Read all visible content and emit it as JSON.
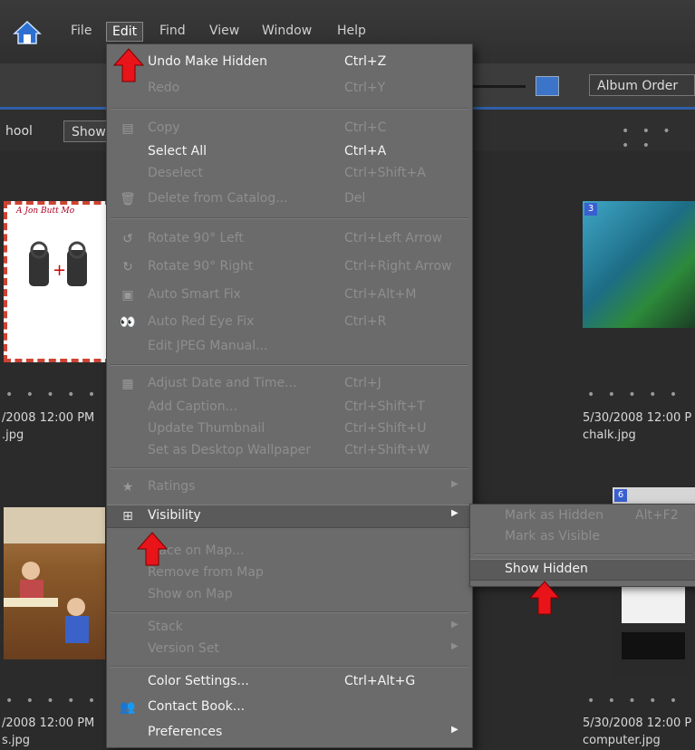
{
  "menubar": {
    "items": [
      {
        "label": "File"
      },
      {
        "label": "Edit"
      },
      {
        "label": "Find"
      },
      {
        "label": "View"
      },
      {
        "label": "Window"
      },
      {
        "label": "Help"
      }
    ]
  },
  "toolbar": {
    "album_order": "Album Order"
  },
  "subheader": {
    "breadcrumb_text": "hool",
    "show_button": "Show"
  },
  "thumbnails": [
    {
      "date": "/2008 12:00 PM",
      "filename": ".jpg"
    },
    {
      "date": "5/30/2008 12:00 P",
      "filename": "chalk.jpg",
      "badge": "3"
    },
    {
      "date": "/2008 12:00 PM",
      "filename": "s.jpg"
    },
    {
      "date": "5/30/2008 12:00 P",
      "filename": "computer.jpg",
      "badge": "6"
    }
  ],
  "thumbnail_stars": "• • • • •",
  "card_title": "A Jon Butt Mo",
  "edit_menu": {
    "items": [
      {
        "label": "Undo Make Hidden",
        "shortcut": "Ctrl+Z"
      },
      {
        "label": "Redo",
        "shortcut": "Ctrl+Y"
      },
      {
        "label": "Copy",
        "shortcut": "Ctrl+C"
      },
      {
        "label": "Select All",
        "shortcut": "Ctrl+A"
      },
      {
        "label": "Deselect",
        "shortcut": "Ctrl+Shift+A"
      },
      {
        "label": "Delete from Catalog...",
        "shortcut": "Del"
      },
      {
        "label": "Rotate 90° Left",
        "shortcut": "Ctrl+Left Arrow"
      },
      {
        "label": "Rotate 90° Right",
        "shortcut": "Ctrl+Right Arrow"
      },
      {
        "label": "Auto Smart Fix",
        "shortcut": "Ctrl+Alt+M"
      },
      {
        "label": "Auto Red Eye Fix",
        "shortcut": "Ctrl+R"
      },
      {
        "label": "Edit JPEG Manual...",
        "shortcut": ""
      },
      {
        "label": "Adjust Date and Time...",
        "shortcut": "Ctrl+J"
      },
      {
        "label": "Add Caption...",
        "shortcut": "Ctrl+Shift+T"
      },
      {
        "label": "Update Thumbnail",
        "shortcut": "Ctrl+Shift+U"
      },
      {
        "label": "Set as Desktop Wallpaper",
        "shortcut": "Ctrl+Shift+W"
      },
      {
        "label": "Ratings",
        "shortcut": ""
      },
      {
        "label": "Visibility",
        "shortcut": ""
      },
      {
        "label": "Place on Map...",
        "shortcut": ""
      },
      {
        "label": "Remove from Map",
        "shortcut": ""
      },
      {
        "label": "Show on Map",
        "shortcut": ""
      },
      {
        "label": "Stack",
        "shortcut": ""
      },
      {
        "label": "Version Set",
        "shortcut": ""
      },
      {
        "label": "Color Settings...",
        "shortcut": "Ctrl+Alt+G"
      },
      {
        "label": "Contact Book...",
        "shortcut": ""
      },
      {
        "label": "Preferences",
        "shortcut": ""
      }
    ]
  },
  "visibility_submenu": {
    "items": [
      {
        "label": "Mark as Hidden",
        "shortcut": "Alt+F2"
      },
      {
        "label": "Mark as Visible",
        "shortcut": ""
      },
      {
        "label": "Show Hidden",
        "shortcut": ""
      }
    ]
  },
  "colors": {
    "menu_bg": "#6b6b6b",
    "highlight": "#5a5a5a",
    "accent_blue": "#2f5fa8",
    "arrow_red": "#e8141a"
  }
}
